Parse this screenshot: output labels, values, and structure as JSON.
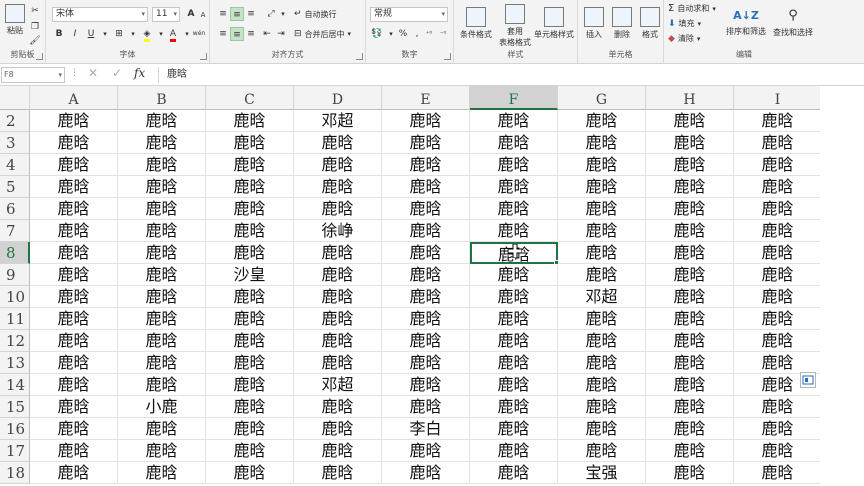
{
  "ribbon": {
    "clipboard": {
      "paste_label": "粘贴",
      "group_label": "剪贴板"
    },
    "font": {
      "font_name": "宋体",
      "font_size": "11",
      "bold": "B",
      "italic": "I",
      "underline": "U",
      "grow": "A",
      "shrink": "A",
      "font_color_label": "A",
      "wen": "wén",
      "group_label": "字体"
    },
    "alignment": {
      "wrap_label": "自动换行",
      "merge_label": "合并后居中",
      "group_label": "对齐方式"
    },
    "number": {
      "format": "常规",
      "percent": "%",
      "comma": ",",
      "group_label": "数字"
    },
    "styles": {
      "cond_format": "条件格式",
      "table_format_top": "套用",
      "table_format_bottom": "表格格式",
      "cell_styles": "单元格样式",
      "group_label": "样式"
    },
    "cells": {
      "insert": "插入",
      "delete": "删除",
      "format": "格式",
      "group_label": "单元格"
    },
    "editing": {
      "autosum": "自动求和",
      "fill": "填充",
      "clear": "清除",
      "sort_filter": "排序和筛选",
      "find_select": "查找和选择",
      "group_label": "编辑"
    }
  },
  "formula_bar": {
    "name_box": "F8",
    "dots": "⋮",
    "cancel": "✕",
    "enter": "✓",
    "fx": "fx",
    "content": "鹿晗"
  },
  "columns": [
    "A",
    "B",
    "C",
    "D",
    "E",
    "F",
    "G",
    "H",
    "I"
  ],
  "selected_column": "F",
  "selected_row": "8",
  "rows": [
    {
      "num": "2",
      "cells": [
        "鹿晗",
        "鹿晗",
        "鹿晗",
        "邓超",
        "鹿晗",
        "鹿晗",
        "鹿晗",
        "鹿晗",
        "鹿晗"
      ]
    },
    {
      "num": "3",
      "cells": [
        "鹿晗",
        "鹿晗",
        "鹿晗",
        "鹿晗",
        "鹿晗",
        "鹿晗",
        "鹿晗",
        "鹿晗",
        "鹿晗"
      ]
    },
    {
      "num": "4",
      "cells": [
        "鹿晗",
        "鹿晗",
        "鹿晗",
        "鹿晗",
        "鹿晗",
        "鹿晗",
        "鹿晗",
        "鹿晗",
        "鹿晗"
      ]
    },
    {
      "num": "5",
      "cells": [
        "鹿晗",
        "鹿晗",
        "鹿晗",
        "鹿晗",
        "鹿晗",
        "鹿晗",
        "鹿晗",
        "鹿晗",
        "鹿晗"
      ]
    },
    {
      "num": "6",
      "cells": [
        "鹿晗",
        "鹿晗",
        "鹿晗",
        "鹿晗",
        "鹿晗",
        "鹿晗",
        "鹿晗",
        "鹿晗",
        "鹿晗"
      ]
    },
    {
      "num": "7",
      "cells": [
        "鹿晗",
        "鹿晗",
        "鹿晗",
        "徐峥",
        "鹿晗",
        "鹿晗",
        "鹿晗",
        "鹿晗",
        "鹿晗"
      ]
    },
    {
      "num": "8",
      "cells": [
        "鹿晗",
        "鹿晗",
        "鹿晗",
        "鹿晗",
        "鹿晗",
        "鹿晗",
        "鹿晗",
        "鹿晗",
        "鹿晗"
      ]
    },
    {
      "num": "9",
      "cells": [
        "鹿晗",
        "鹿晗",
        "沙皇",
        "鹿晗",
        "鹿晗",
        "鹿晗",
        "鹿晗",
        "鹿晗",
        "鹿晗"
      ]
    },
    {
      "num": "10",
      "cells": [
        "鹿晗",
        "鹿晗",
        "鹿晗",
        "鹿晗",
        "鹿晗",
        "鹿晗",
        "邓超",
        "鹿晗",
        "鹿晗"
      ]
    },
    {
      "num": "11",
      "cells": [
        "鹿晗",
        "鹿晗",
        "鹿晗",
        "鹿晗",
        "鹿晗",
        "鹿晗",
        "鹿晗",
        "鹿晗",
        "鹿晗"
      ]
    },
    {
      "num": "12",
      "cells": [
        "鹿晗",
        "鹿晗",
        "鹿晗",
        "鹿晗",
        "鹿晗",
        "鹿晗",
        "鹿晗",
        "鹿晗",
        "鹿晗"
      ]
    },
    {
      "num": "13",
      "cells": [
        "鹿晗",
        "鹿晗",
        "鹿晗",
        "鹿晗",
        "鹿晗",
        "鹿晗",
        "鹿晗",
        "鹿晗",
        "鹿晗"
      ]
    },
    {
      "num": "14",
      "cells": [
        "鹿晗",
        "鹿晗",
        "鹿晗",
        "邓超",
        "鹿晗",
        "鹿晗",
        "鹿晗",
        "鹿晗",
        "鹿晗"
      ]
    },
    {
      "num": "15",
      "cells": [
        "鹿晗",
        "小鹿",
        "鹿晗",
        "鹿晗",
        "鹿晗",
        "鹿晗",
        "鹿晗",
        "鹿晗",
        "鹿晗"
      ]
    },
    {
      "num": "16",
      "cells": [
        "鹿晗",
        "鹿晗",
        "鹿晗",
        "鹿晗",
        "李白",
        "鹿晗",
        "鹿晗",
        "鹿晗",
        "鹿晗"
      ]
    },
    {
      "num": "17",
      "cells": [
        "鹿晗",
        "鹿晗",
        "鹿晗",
        "鹿晗",
        "鹿晗",
        "鹿晗",
        "鹿晗",
        "鹿晗",
        "鹿晗"
      ]
    },
    {
      "num": "18",
      "cells": [
        "鹿晗",
        "鹿晗",
        "鹿晗",
        "鹿晗",
        "鹿晗",
        "鹿晗",
        "宝强",
        "鹿晗",
        "鹿晗"
      ]
    }
  ],
  "colors": {
    "accent": "#217346",
    "header_bg": "#f3f3f3",
    "selected_header_bg": "#d2d2d2"
  }
}
